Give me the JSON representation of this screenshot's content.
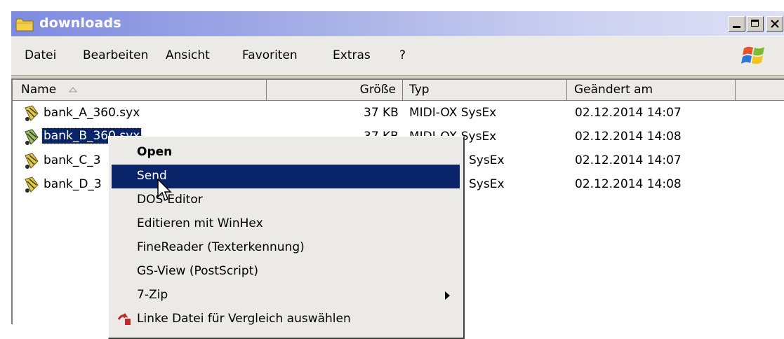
{
  "window": {
    "title": "downloads",
    "icon": "folder-icon",
    "controls": [
      "minimize-icon",
      "maximize-icon",
      "close-icon"
    ]
  },
  "menubar": {
    "items": [
      "Datei",
      "Bearbeiten",
      "Ansicht",
      "Favoriten",
      "Extras",
      "?"
    ],
    "logo": "windows-logo-icon"
  },
  "columns": {
    "name": "Name",
    "size": "Größe",
    "type": "Typ",
    "modified": "Geändert am",
    "sort_indicator": "sort-ascending-icon"
  },
  "files": [
    {
      "name": "bank_A_360.syx",
      "size": "37 KB",
      "type": "MIDI-OX SysEx",
      "modified": "02.12.2014 14:07",
      "icon": "midi-file-icon"
    },
    {
      "name": "bank_B_360.syx",
      "size": "37 KB",
      "type": "MIDI-OX SysEx",
      "modified": "02.12.2014 14:08",
      "icon": "midi-file-icon",
      "selected": true
    },
    {
      "name": "bank_C_3",
      "size": "",
      "type": "SysEx",
      "modified": "02.12.2014 14:07",
      "icon": "midi-file-icon"
    },
    {
      "name": "bank_D_3",
      "size": "",
      "type": "SysEx",
      "modified": "02.12.2014 14:08",
      "icon": "midi-file-icon"
    }
  ],
  "context_menu": {
    "items": [
      {
        "label": "Open",
        "bold": true
      },
      {
        "label": "Send",
        "highlighted": true
      },
      {
        "label": "DOS-Editor"
      },
      {
        "label": "Editieren mit WinHex"
      },
      {
        "label": "FineReader (Texterkennung)"
      },
      {
        "label": "GS-View (PostScript)"
      },
      {
        "label": "7-Zip",
        "submenu": true
      },
      {
        "label": "Linke Datei für Vergleich auswählen",
        "icon": "compare-icon"
      }
    ]
  },
  "colors": {
    "selection": "#0a246a",
    "window_face": "#d4d0c8",
    "titlebar_start": "#7e8ae0"
  }
}
